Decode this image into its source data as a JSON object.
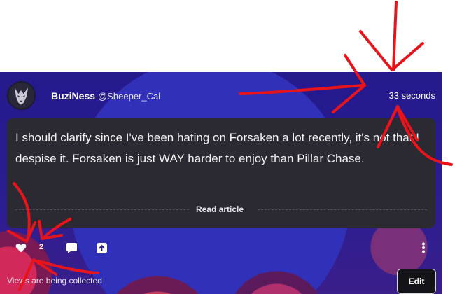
{
  "post": {
    "author": {
      "display_name": "BuziNess",
      "handle": "@Sheeper_Cal"
    },
    "timestamp": "33 seconds",
    "body": "I should clarify since I've been hating on Forsaken a lot recently, it's not that I despise it. Forsaken is just WAY harder to enjoy than Pillar Chase.",
    "read_article_label": "Read article",
    "like_count": "2",
    "views_text": "Views are being collected",
    "edit_label": "Edit"
  },
  "icons": {
    "like": "heart-icon",
    "comment": "comment-icon",
    "share": "share-icon",
    "more": "more-vertical-icon",
    "avatar": "wolf-avatar"
  },
  "colors": {
    "annotation_red": "#e8141b",
    "card_bg": "#2b2a33",
    "post_bg": "#241a8c"
  }
}
